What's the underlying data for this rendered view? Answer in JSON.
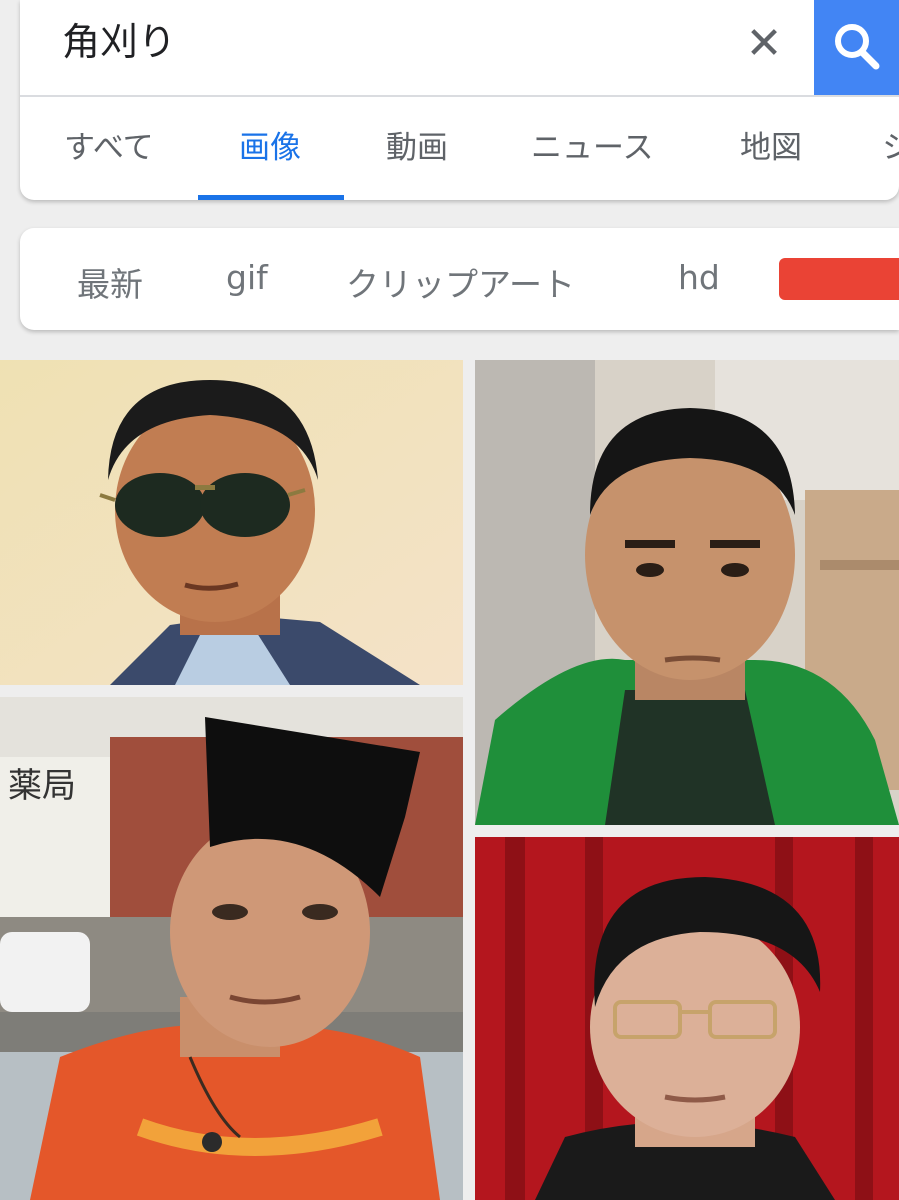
{
  "search": {
    "query": "角刈り"
  },
  "tabs": [
    {
      "label": "すべて",
      "active": false
    },
    {
      "label": "画像",
      "active": true
    },
    {
      "label": "動画",
      "active": false
    },
    {
      "label": "ニュース",
      "active": false
    },
    {
      "label": "地図",
      "active": false
    },
    {
      "label": "シ",
      "active": false
    }
  ],
  "chips": [
    {
      "label": "最新"
    },
    {
      "label": "gif"
    },
    {
      "label": "クリップアート"
    },
    {
      "label": "hd"
    }
  ],
  "colors": {
    "accent": "#1a73e8",
    "search_button": "#4285f4",
    "color_chip": "#ea4335"
  },
  "images": [
    {
      "description": "man with sunglasses in suit"
    },
    {
      "description": "man with short flat haircut in green hoodie"
    },
    {
      "description": "man with tall flat-top haircut in street"
    },
    {
      "description": "man with glasses in front of red curtain"
    }
  ]
}
